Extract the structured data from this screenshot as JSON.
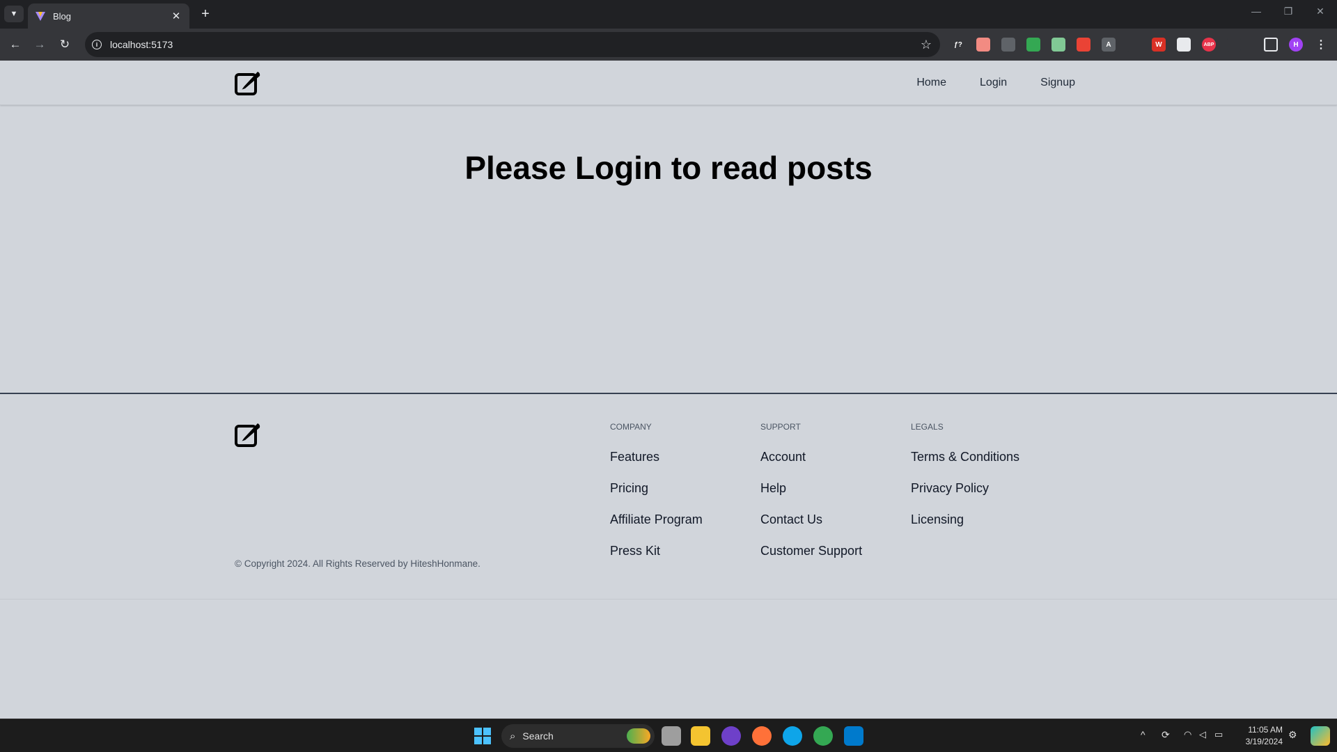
{
  "browser": {
    "tab_title": "Blog",
    "url": "localhost:5173",
    "tab_menu_icon": "chevron-down-icon",
    "new_tab_label": "+",
    "close_tab_label": "✕",
    "back_label": "←",
    "forward_label": "→",
    "reload_label": "↻",
    "minimize_label": "—",
    "restore_label": "❐",
    "close_label": "✕",
    "star_label": "☆",
    "profile_initial": "H"
  },
  "extensions": [
    {
      "name": "fx-extension-icon",
      "text": "ƒ?",
      "color": "#35363a"
    },
    {
      "name": "calendar-extension-icon",
      "text": "",
      "color": "#f28b82"
    },
    {
      "name": "strike-extension-icon",
      "text": "",
      "color": "#5f6368"
    },
    {
      "name": "color-wheel-extension-icon",
      "text": "",
      "color": "#34a853"
    },
    {
      "name": "image-extension-icon",
      "text": "",
      "color": "#81c995"
    },
    {
      "name": "record-extension-icon",
      "text": "",
      "color": "#ea4335"
    },
    {
      "name": "font-extension-icon",
      "text": "A",
      "color": "#5f6368"
    },
    {
      "name": "eyedropper-extension-icon",
      "text": "",
      "color": "#35363a"
    },
    {
      "name": "wappalyzer-extension-icon",
      "text": "W",
      "color": "#d93025"
    },
    {
      "name": "bookmark-extension-icon",
      "text": "",
      "color": "#e8eaed"
    },
    {
      "name": "adblock-extension-icon",
      "text": "ABP",
      "color": "#e8334a"
    },
    {
      "name": "puzzle-extension-icon",
      "text": "",
      "color": "#35363a"
    }
  ],
  "site": {
    "nav": [
      "Home",
      "Login",
      "Signup"
    ],
    "hero_text": "Please Login to read posts"
  },
  "footer": {
    "copyright": "© Copyright 2024. All Rights Reserved by HiteshHonmane.",
    "columns": [
      {
        "heading": "COMPANY",
        "links": [
          "Features",
          "Pricing",
          "Affiliate Program",
          "Press Kit"
        ]
      },
      {
        "heading": "SUPPORT",
        "links": [
          "Account",
          "Help",
          "Contact Us",
          "Customer Support"
        ]
      },
      {
        "heading": "LEGALS",
        "links": [
          "Terms & Conditions",
          "Privacy Policy",
          "Licensing"
        ]
      }
    ]
  },
  "taskbar": {
    "search_placeholder": "Search",
    "time": "11:05 AM",
    "date": "3/19/2024"
  },
  "colors": {
    "page_bg": "#d1d5db",
    "chrome_dark": "#202124",
    "chrome_toolbar": "#35363a",
    "taskbar_bg": "#1c1c1c"
  }
}
